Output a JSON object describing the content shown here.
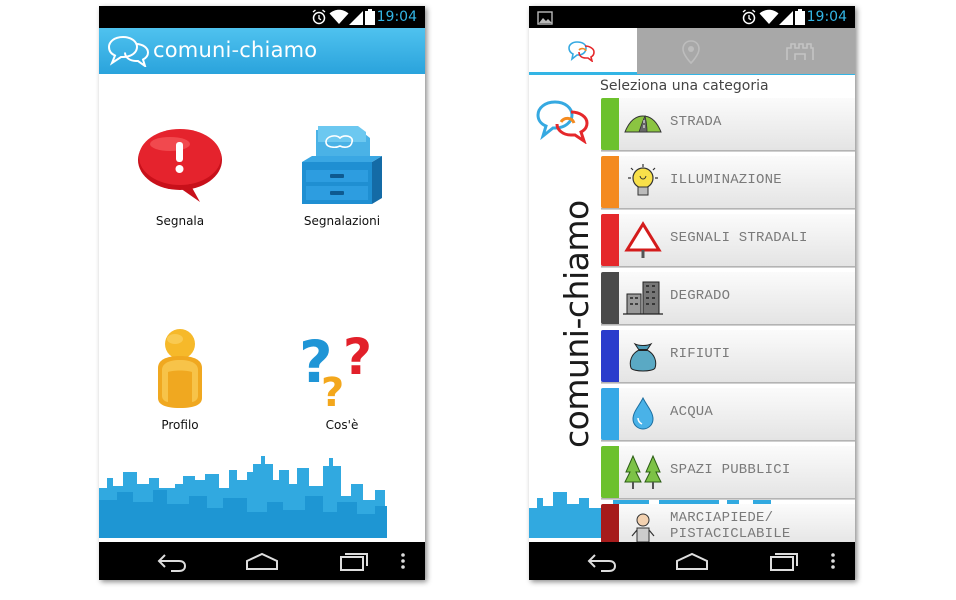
{
  "status": {
    "time": "19:04"
  },
  "home": {
    "app_title_main": "comuni",
    "app_title_sep": "-",
    "app_title_rest": "chiamo",
    "tiles": [
      {
        "label": "Segnala"
      },
      {
        "label": "Segnalazioni"
      },
      {
        "label": "Profilo"
      },
      {
        "label": "Cos'è"
      }
    ]
  },
  "categories": {
    "heading": "Seleziona una categoria",
    "brand": "comuni-chiamo",
    "items": [
      {
        "label": "STRADA",
        "color": "#6cc12d",
        "icon": "road-icon"
      },
      {
        "label": "ILLUMINAZIONE",
        "color": "#f48a1f",
        "icon": "lightbulb-icon"
      },
      {
        "label": "SEGNALI STRADALI",
        "color": "#e5282b",
        "icon": "warning-sign-icon"
      },
      {
        "label": "DEGRADO",
        "color": "#4a4a4a",
        "icon": "buildings-icon"
      },
      {
        "label": "RIFIUTI",
        "color": "#2a3ccc",
        "icon": "trash-bag-icon"
      },
      {
        "label": "ACQUA",
        "color": "#35a8e6",
        "icon": "water-drop-icon"
      },
      {
        "label": "SPAZI PUBBLICI",
        "color": "#6cc12d",
        "icon": "trees-icon"
      },
      {
        "label": "MARCIAPIEDE/ PISTACICLABILE",
        "color": "#a61b1b",
        "icon": "pedestrian-icon"
      }
    ]
  },
  "colors": {
    "accent": "#33b5e5",
    "appbar": "#2aa3dc",
    "alert_red": "#d9141e",
    "folder_blue": "#1f8fd2"
  }
}
